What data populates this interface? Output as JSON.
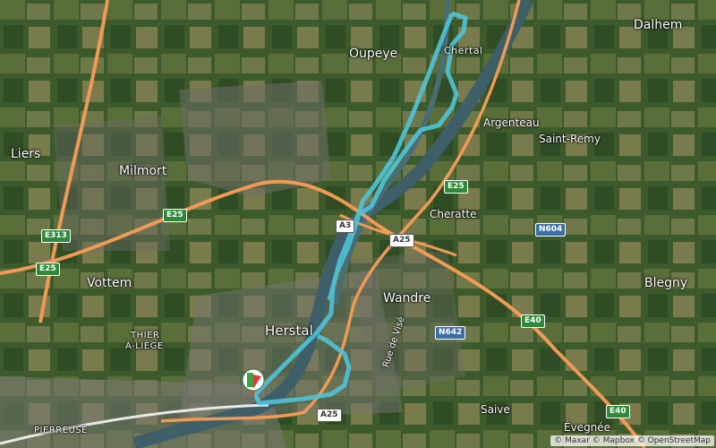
{
  "map": {
    "places": {
      "dalhem": "Dalhem",
      "oupeye": "Oupeye",
      "cheratal": "Chertal",
      "argenteau": "Argenteau",
      "saint_remy": "Saint-Remy",
      "liers": "Liers",
      "milmort": "Milmort",
      "cheratte": "Cheratte",
      "vottem": "Vottem",
      "wandre": "Wandre",
      "blegny": "Blegny",
      "herstal": "Herstal",
      "thier_line1": "THIER",
      "thier_line2": "À-LIÈGE",
      "pierreuse": "PIERREUSE",
      "saive": "Saive",
      "evegnee": "Évegnée"
    },
    "roads": {
      "rue_de_vise": "Rue de Visé"
    },
    "shields": {
      "e313": "E313",
      "e25_west": "E25",
      "e25_mid": "E25",
      "e25_north": "E25",
      "a3": "A3",
      "a25_mid": "A25",
      "a25_south": "A25",
      "n604": "N604",
      "n642": "N642",
      "e40_mid": "E40",
      "e40_south": "E40"
    },
    "attribution": "© Maxar © Mapbox © OpenStreetMap",
    "colors": {
      "route": "#4fc3d9",
      "highway": "#f09a55",
      "river": "#3e5f68",
      "marker_red": "#e53935",
      "marker_green": "#43a047"
    }
  }
}
